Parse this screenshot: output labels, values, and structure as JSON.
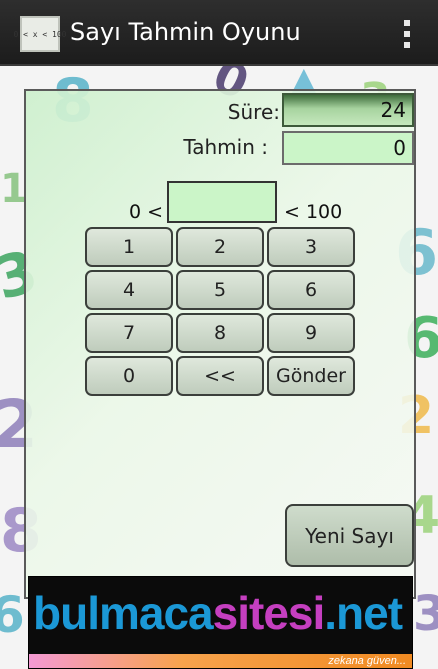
{
  "actionbar": {
    "app_icon_text": "0 < x < 100",
    "title": "Sayı Tahmin Oyunu"
  },
  "stats": {
    "time_label": "Süre:",
    "time_value": "24",
    "guess_label": "Tahmin :",
    "guess_value": "0"
  },
  "range": {
    "low": "0 <",
    "high": "< 100",
    "input_value": ""
  },
  "keypad": {
    "k1": "1",
    "k2": "2",
    "k3": "3",
    "k4": "4",
    "k5": "5",
    "k6": "6",
    "k7": "7",
    "k8": "8",
    "k9": "9",
    "k0": "0",
    "back": "<<",
    "send": "Gönder"
  },
  "new_number_button": "Yeni Sayı",
  "banner": {
    "word_part1": "bulmaca",
    "word_part2": "sitesi",
    "word_part3": ".net",
    "slogan": "zekana güven..."
  },
  "colors": {
    "action_bar": "#1c1c1c",
    "panel_green": "#cdf0cd",
    "field_green": "#cbf5c8",
    "banner_blue": "#1b98d6",
    "banner_pink": "#c53fc0"
  }
}
